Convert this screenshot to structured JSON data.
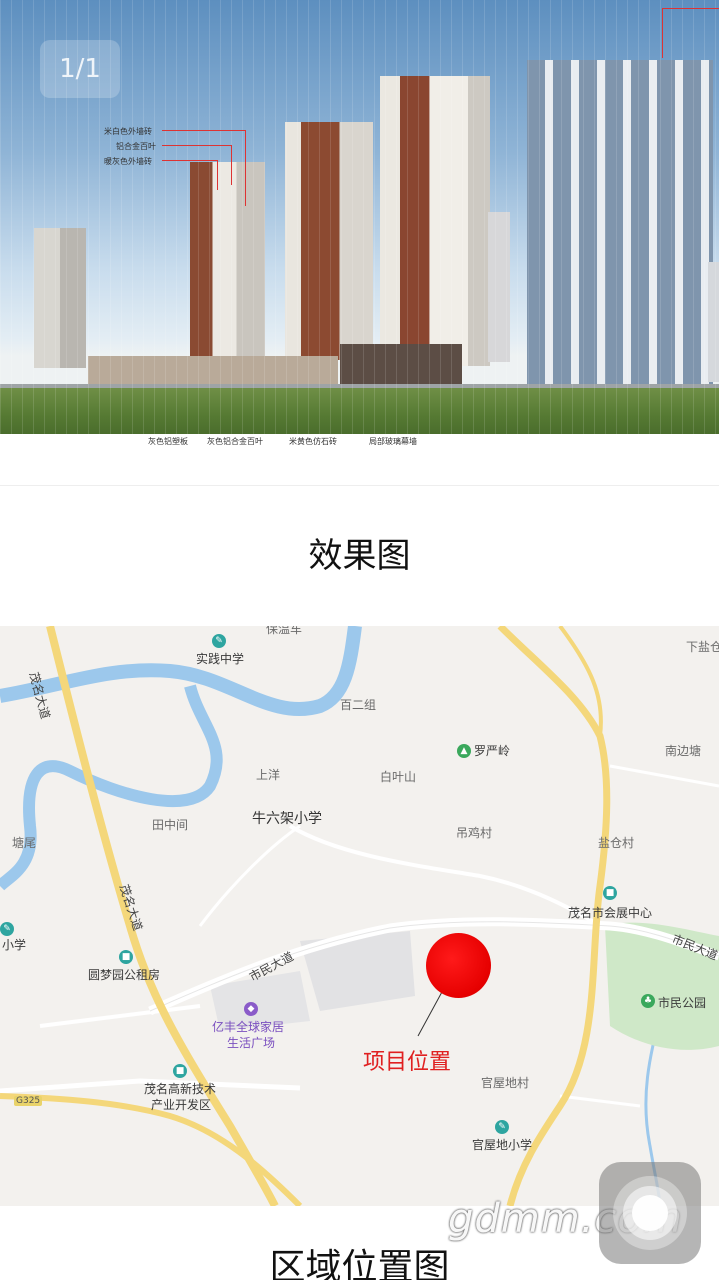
{
  "viewer": {
    "pager": "1/1"
  },
  "rendering": {
    "callouts_top": [
      "米白色外墙砖",
      "铝合金百叶",
      "暖灰色外墙砖"
    ],
    "callouts_bottom": [
      "灰色铝塑板",
      "灰色铝合金百叶",
      "米黄色仿石砖",
      "局部玻璃幕墙"
    ]
  },
  "captions": {
    "rendering": "效果图",
    "location_map": "区域位置图"
  },
  "map": {
    "roads": [
      "茂名大道",
      "茂名大道",
      "市民大道",
      "市民大道"
    ],
    "places": [
      "保温车",
      "百二组",
      "上洋",
      "白叶山",
      "田中间",
      "塘尾",
      "吊鸡村",
      "盐仓村",
      "南边塘",
      "下盐仓",
      "官屋地村"
    ],
    "poi": {
      "school1": "实践中学",
      "hill": "罗严岭",
      "school2": "牛六架小学",
      "convention": "茂名市会展中心",
      "park": "市民公园",
      "rental": "圆梦园公租房",
      "mall_line1": "亿丰全球家居",
      "mall_line2": "生活广场",
      "hightech_line1": "茂名高新技术",
      "hightech_line2": "产业开发区",
      "school3": "官屋地小学",
      "school_edge": "小学",
      "highway": "G325"
    },
    "project_label": "项目位置"
  },
  "watermark": "gdmm.com",
  "colors": {
    "project_marker": "#e60000",
    "river": "#9cc8ec",
    "major_road": "#f4d77a",
    "park": "#cfe8c8"
  }
}
